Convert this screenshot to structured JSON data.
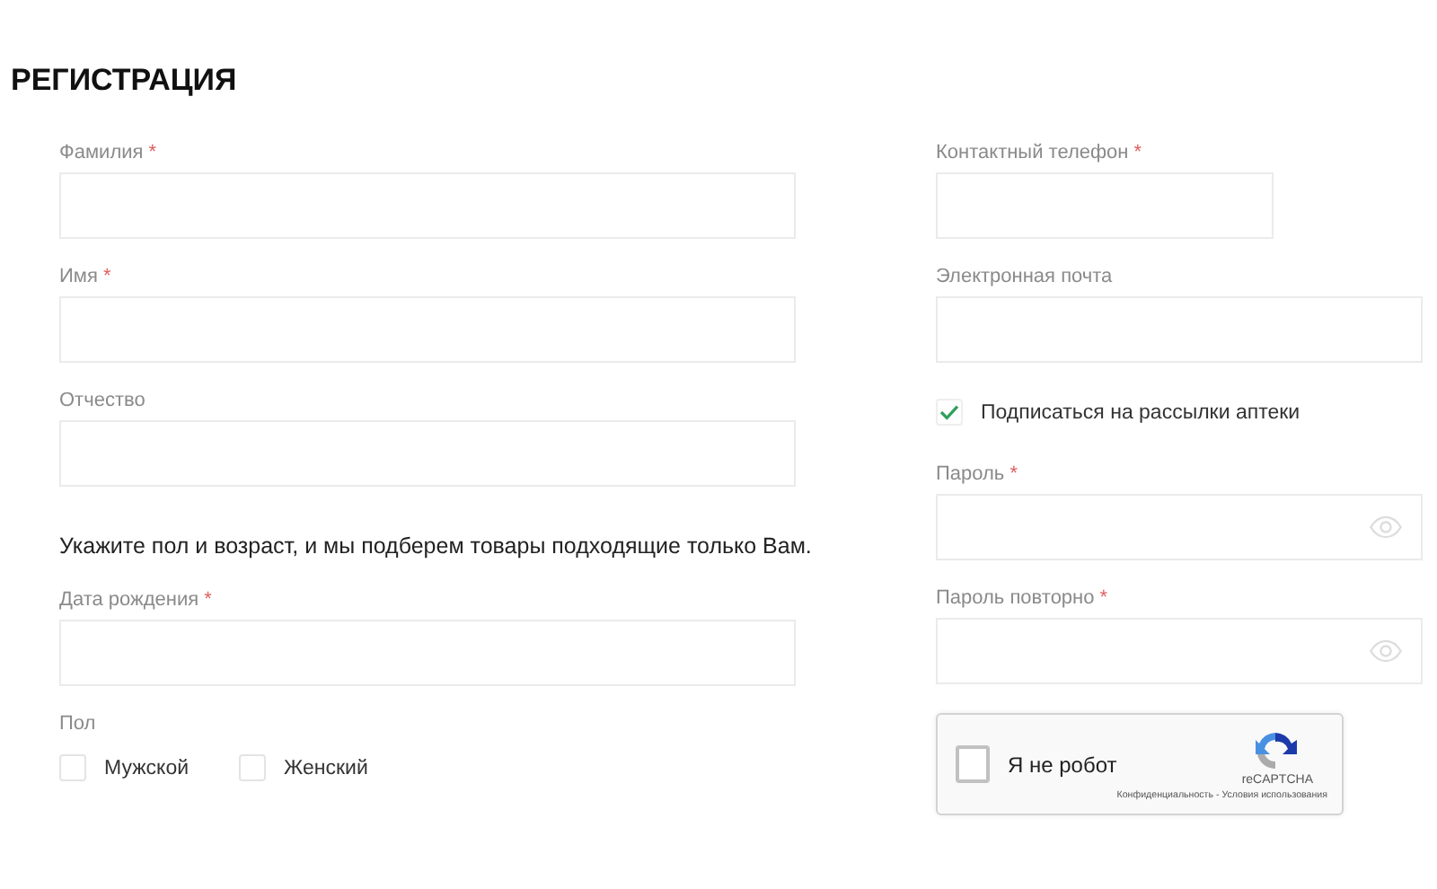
{
  "title": "РЕГИСТРАЦИЯ",
  "left": [
    {
      "kind": "field",
      "label": "Фамилия",
      "required_mark": "*"
    },
    {
      "kind": "field",
      "label": "Имя",
      "required_mark": "*"
    },
    {
      "kind": "field",
      "label": "Отчество"
    },
    {
      "kind": "note",
      "text": "Укажите пол и возраст, и мы подберем товары подходящие только Вам."
    },
    {
      "kind": "field",
      "label": "Дата рождения",
      "required_mark": "*"
    },
    {
      "kind": "group",
      "label": "Пол",
      "options": [
        {
          "label": "Мужской",
          "checked": false
        },
        {
          "label": "Женский",
          "checked": false
        }
      ]
    }
  ],
  "right": [
    {
      "kind": "phone",
      "label": "Контактный телефон",
      "required_mark": "*"
    },
    {
      "kind": "field",
      "label": "Электронная почта"
    },
    {
      "kind": "checkbox",
      "label": "Подписаться на рассылки аптеки",
      "checked": true
    },
    {
      "kind": "password",
      "label": "Пароль",
      "required_mark": "*"
    },
    {
      "kind": "password",
      "label": "Пароль повторно",
      "required_mark": "*"
    },
    {
      "kind": "captcha",
      "label": "Я не робот",
      "checked": false,
      "brand": "reCAPTCHA",
      "footer": "Конфиденциальность - Условия использования"
    }
  ]
}
